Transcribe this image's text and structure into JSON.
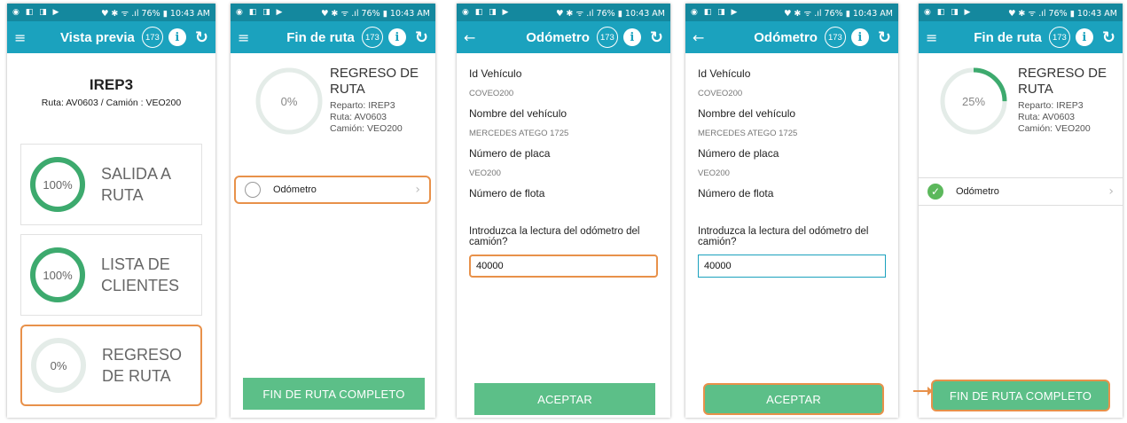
{
  "status_bar": {
    "left_icons": "◉ ◧ ◨ ▶",
    "right": "♥ ✱ ᯤ .ıl 76% ▮ 10:43 AM"
  },
  "badge_count": "173",
  "screen1": {
    "title": "Vista previa",
    "name": "IREP3",
    "subtitle": "Ruta: AV0603 / Camión : VEO200",
    "stages": [
      {
        "percent": "100%",
        "progress": 1.0,
        "label_line1": "SALIDA A",
        "label_line2": "RUTA"
      },
      {
        "percent": "100%",
        "progress": 1.0,
        "label_line1": "LISTA DE",
        "label_line2": "CLIENTES"
      },
      {
        "percent": "0%",
        "progress": 0.0,
        "label_line1": "REGRESO",
        "label_line2": "DE RUTA"
      }
    ]
  },
  "screen2": {
    "title": "Fin de ruta",
    "percent": "0%",
    "progress": 0.0,
    "heading_line1": "REGRESO DE",
    "heading_line2": "RUTA",
    "reparto": "Reparto: IREP3",
    "ruta": "Ruta: AV0603",
    "camion": "Camión: VEO200",
    "item_label": "Odómetro",
    "button": "FIN DE RUTA COMPLETO"
  },
  "form": {
    "title": "Odómetro",
    "id_label": "Id Vehículo",
    "id_value": "COVEO200",
    "name_label": "Nombre del vehículo",
    "name_value": "MERCEDES ATEGO 1725",
    "plate_label": "Número de placa",
    "plate_value": "VEO200",
    "fleet_label": "Número de flota",
    "question": "Introduzca la lectura del odómetro del camión?",
    "input_value": "40000",
    "button": "ACEPTAR"
  },
  "screen5": {
    "title": "Fin de ruta",
    "percent": "25%",
    "progress": 0.25,
    "heading_line1": "REGRESO DE",
    "heading_line2": "RUTA",
    "reparto": "Reparto: IREP3",
    "ruta": "Ruta: AV0603",
    "camion": "Camión: VEO200",
    "item_label": "Odómetro",
    "button": "FIN DE RUTA COMPLETO"
  },
  "colors": {
    "status_bar": "#14889e",
    "app_bar": "#1ba2be",
    "ring": "#3daa6e",
    "button": "#5cbf88",
    "highlight": "#e8914a"
  }
}
